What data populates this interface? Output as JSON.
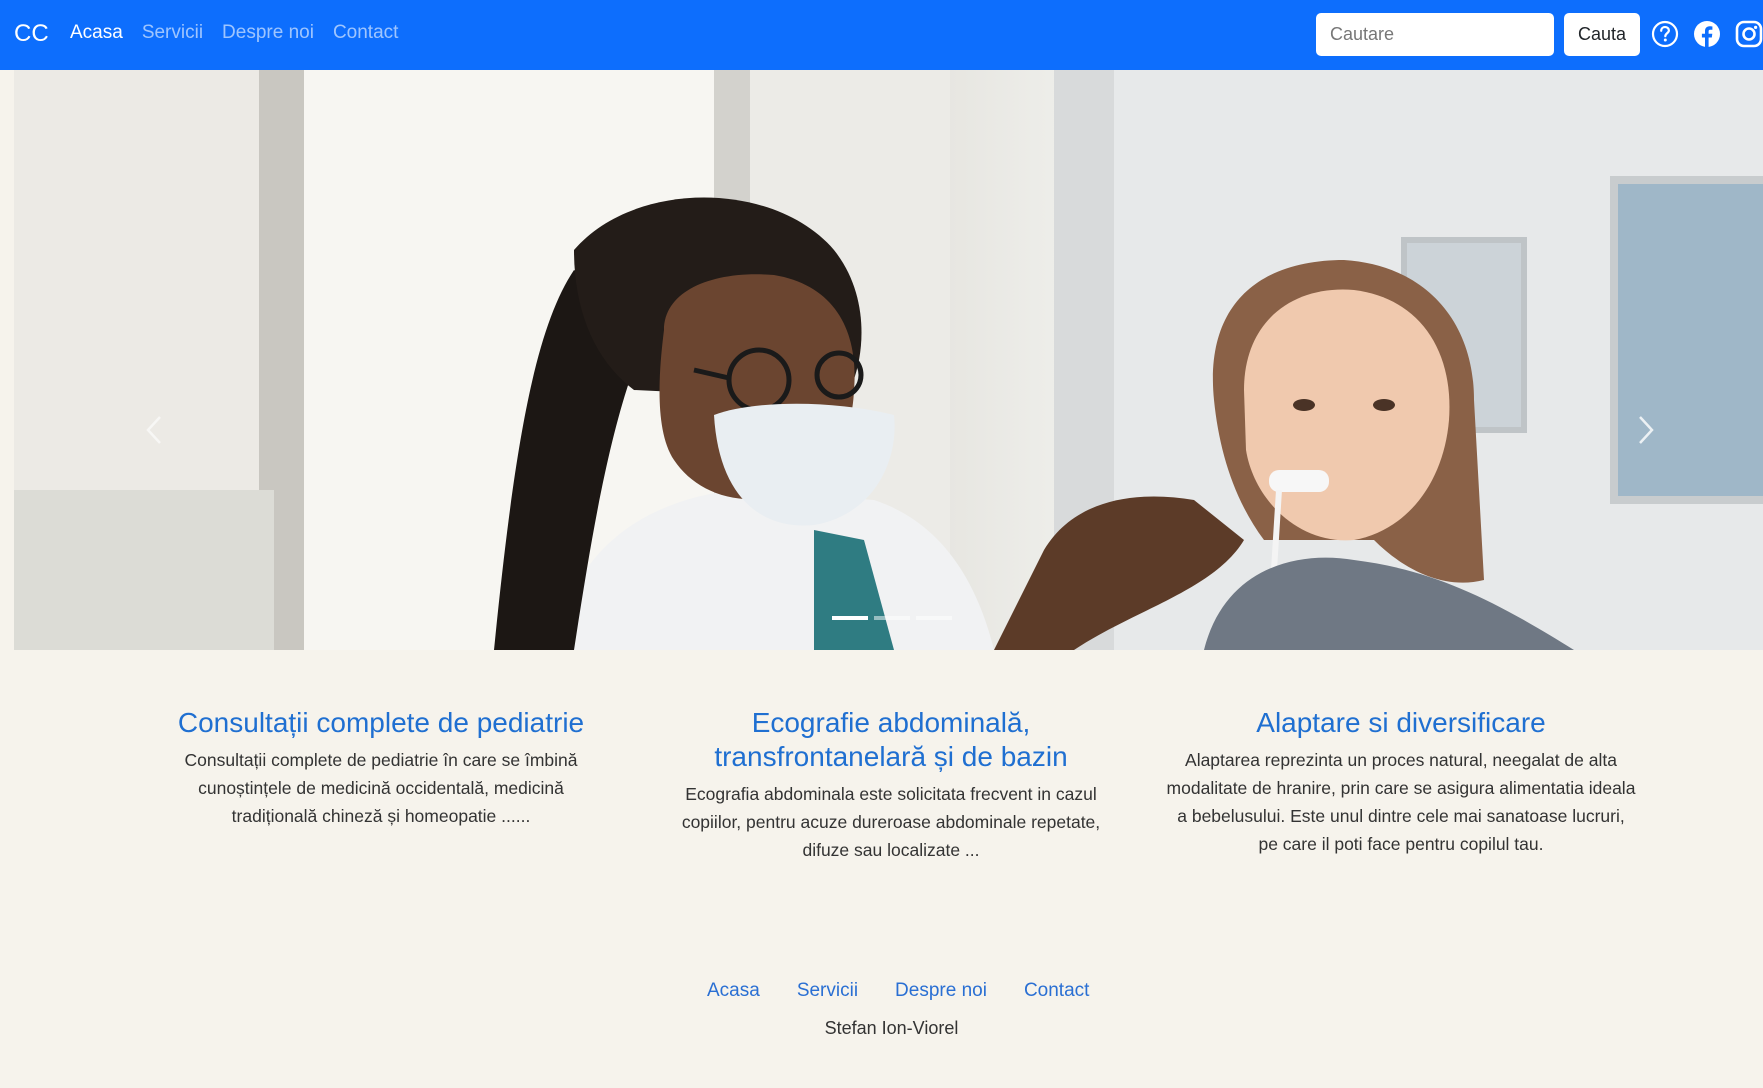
{
  "navbar": {
    "brand": "CC",
    "links": [
      "Acasa",
      "Servicii",
      "Despre noi",
      "Contact"
    ],
    "search_placeholder": "Cautare",
    "search_button": "Cauta",
    "icons": [
      "question-circle-icon",
      "facebook-icon",
      "instagram-icon"
    ],
    "color": "#0d6efd"
  },
  "carousel": {
    "slides_count": 3,
    "active_slide": 1,
    "image_description": "doctor-with-child-photo"
  },
  "features": [
    {
      "title": "Consultații complete de pediatrie",
      "text": "Consultații complete de pediatrie în care se îmbină cunoștințele de medicină occidentală, medicină tradițională chineză și homeopatie ......"
    },
    {
      "title": "Ecografie abdominală, transfrontanelară și de bazin",
      "text": "Ecografia abdominala este solicitata frecvent in cazul copiilor, pentru acuze dureroase abdominale repetate, difuze sau localizate ..."
    },
    {
      "title": "Alaptare si diversificare",
      "text": "Alaptarea reprezinta un proces natural, neegalat de alta modalitate de hranire, prin care se asigura alimentatia ideala a bebelusului. Este unul dintre cele mai sanatoase lucruri, pe care il poti face pentru copilul tau."
    }
  ],
  "footer": {
    "links": [
      "Acasa",
      "Servicii",
      "Despre noi",
      "Contact"
    ],
    "author": "Stefan Ion-Viorel"
  },
  "colors": {
    "primary": "#0d6efd",
    "heading": "#1f6fd1",
    "background": "#f6f3ec"
  }
}
